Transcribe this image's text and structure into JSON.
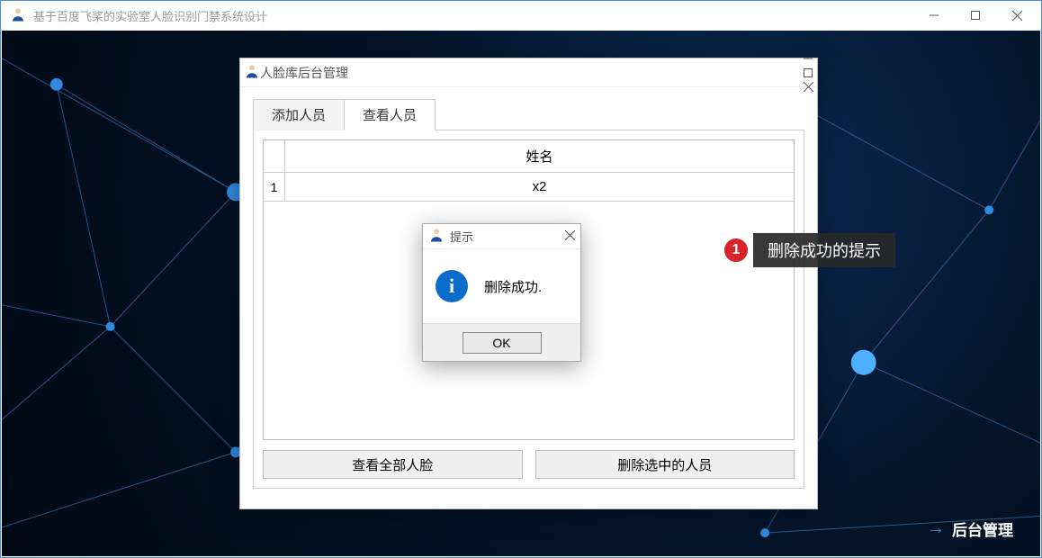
{
  "main_window": {
    "title": "基于百度飞桨的实验室人脸识别门禁系统设计"
  },
  "mgmt_window": {
    "title": "人脸库后台管理",
    "tabs": {
      "add": "添加人员",
      "view": "查看人员"
    },
    "table": {
      "header": "姓名",
      "rows": [
        {
          "index": "1",
          "name": "x2"
        }
      ]
    },
    "buttons": {
      "view_all": "查看全部人脸",
      "delete_selected": "删除选中的人员"
    }
  },
  "msgbox": {
    "title": "提示",
    "message": "删除成功.",
    "ok": "OK"
  },
  "callout": {
    "num": "1",
    "text": "删除成功的提示"
  },
  "backend_link": "后台管理"
}
